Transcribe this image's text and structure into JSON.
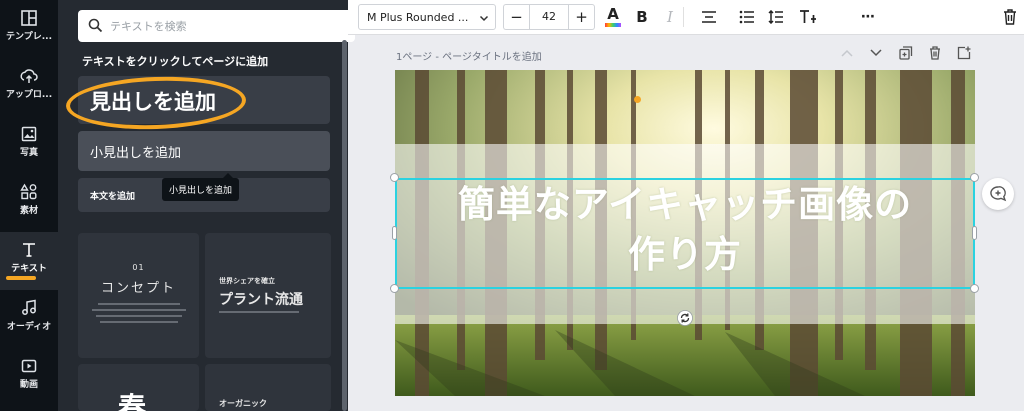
{
  "sidebar": {
    "items": [
      {
        "icon": "templates-icon",
        "label": "テンプレ..."
      },
      {
        "icon": "upload-icon",
        "label": "アップロ..."
      },
      {
        "icon": "photo-icon",
        "label": "写真"
      },
      {
        "icon": "elements-icon",
        "label": "素材"
      },
      {
        "icon": "text-icon",
        "label": "テキスト",
        "active": true
      },
      {
        "icon": "audio-icon",
        "label": "オーディオ"
      },
      {
        "icon": "video-icon",
        "label": "動画"
      }
    ]
  },
  "panel": {
    "search_placeholder": "テキストを検索",
    "title": "テキストをクリックしてページに追加",
    "add_heading": "見出しを追加",
    "add_subheading": "小見出しを追加",
    "add_body": "本文を追加",
    "tooltip": "小見出しを追加",
    "templates": [
      {
        "number": "01",
        "title": "コンセプト"
      },
      {
        "subtitle": "世界シェアを確立",
        "title": "プラント流通"
      },
      {
        "title": "春"
      },
      {
        "title": "オーガニック"
      }
    ]
  },
  "toolbar": {
    "font": "M Plus Rounded ...",
    "minus": "−",
    "size": "42",
    "plus": "+",
    "text_color_letter": "A",
    "bold": "B",
    "italic": "I",
    "more": "⋯",
    "colors": {
      "text_color_bar": "#ff8a00"
    }
  },
  "page": {
    "label": "1ページ - ページタイトルを追加"
  },
  "canvas": {
    "headline_line1": "簡単なアイキャッチ画像の",
    "headline_line2": "作り方"
  },
  "colors": {
    "accent_orange": "#f5a623",
    "selection": "#2bd2e0",
    "rail_bg": "#0e1318",
    "panel_bg": "#252a31"
  }
}
